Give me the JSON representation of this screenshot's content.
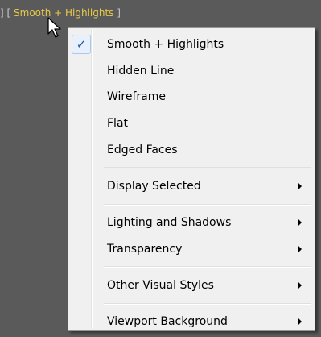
{
  "viewport_label": {
    "open_bracket": "[",
    "text": "Smooth + Highlights",
    "close_bracket": "]",
    "left_fragment": "] ["
  },
  "menu": {
    "items": [
      {
        "label": "Smooth + Highlights",
        "checked": true,
        "submenu": false
      },
      {
        "label": "Hidden Line",
        "checked": false,
        "submenu": false
      },
      {
        "label": "Wireframe",
        "checked": false,
        "submenu": false
      },
      {
        "label": "Flat",
        "checked": false,
        "submenu": false
      },
      {
        "label": "Edged Faces",
        "checked": false,
        "submenu": false
      },
      {
        "label": "Display Selected",
        "checked": false,
        "submenu": true
      },
      {
        "label": "Lighting and Shadows",
        "checked": false,
        "submenu": true
      },
      {
        "label": "Transparency",
        "checked": false,
        "submenu": true
      },
      {
        "label": "Other Visual Styles",
        "checked": false,
        "submenu": true
      },
      {
        "label": "Viewport Background",
        "checked": false,
        "submenu": true
      }
    ],
    "check_glyph": "✓"
  },
  "colors": {
    "viewport_bg": "#5a5a5a",
    "label_text": "#e6c84a",
    "menu_bg": "#f0f0f0",
    "check_color": "#2354a8"
  },
  "icons": {
    "cursor": "arrow-cursor-icon",
    "check": "checkmark-icon",
    "submenu": "submenu-arrow-icon"
  }
}
